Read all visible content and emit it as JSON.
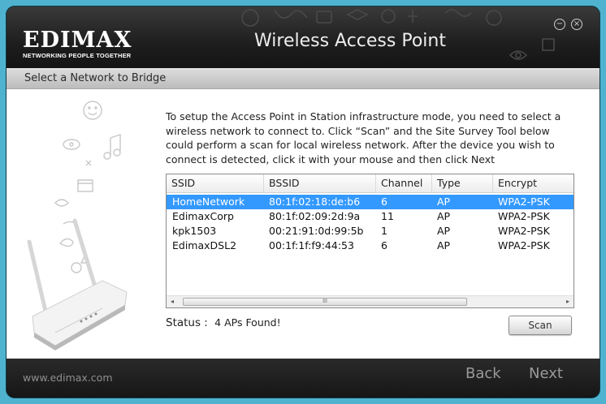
{
  "header": {
    "logo_text": "EDIMAX",
    "logo_tagline": "NETWORKING PEOPLE TOGETHER",
    "title": "Wireless Access Point",
    "minimize_glyph": "−",
    "close_glyph": "×"
  },
  "subheader": {
    "label": "Select a Network to Bridge"
  },
  "description": "To setup the Access Point in Station infrastructure mode, you need to select a wireless network to connect to. Click “Scan” and the Site Survey Tool below could perform a scan for local wireless network. After the device you wish to connect is detected, click it with your mouse and then click Next",
  "table": {
    "columns": [
      "SSID",
      "BSSID",
      "Channel",
      "Type",
      "Encrypt"
    ],
    "rows": [
      {
        "ssid": "HomeNetwork",
        "bssid": "80:1f:02:18:de:b6",
        "channel": "6",
        "type": "AP",
        "encrypt": "WPA2-PSK",
        "selected": true
      },
      {
        "ssid": "EdimaxCorp",
        "bssid": "80:1f:02:09:2d:9a",
        "channel": "11",
        "type": "AP",
        "encrypt": "WPA2-PSK",
        "selected": false
      },
      {
        "ssid": "kpk1503",
        "bssid": "00:21:91:0d:99:5b",
        "channel": "1",
        "type": "AP",
        "encrypt": "WPA2-PSK",
        "selected": false
      },
      {
        "ssid": "EdimaxDSL2",
        "bssid": "00:1f:1f:f9:44:53",
        "channel": "6",
        "type": "AP",
        "encrypt": "WPA2-PSK",
        "selected": false
      }
    ],
    "scroll_left_glyph": "◂",
    "scroll_right_glyph": "▸",
    "thumb_grip": "III"
  },
  "status": {
    "label": "Status :",
    "value": "4 APs Found!"
  },
  "buttons": {
    "scan": "Scan",
    "back": "Back",
    "next": "Next"
  },
  "footer": {
    "url": "www.edimax.com"
  },
  "icons": [
    "minimize-icon",
    "close-icon",
    "router-illustration",
    "scroll-left-icon",
    "scroll-right-icon"
  ],
  "colors": {
    "background": "#4fb3cf",
    "header": "#1e1e1e",
    "selection": "#3399ff",
    "subbar": "#cfcfcf"
  }
}
